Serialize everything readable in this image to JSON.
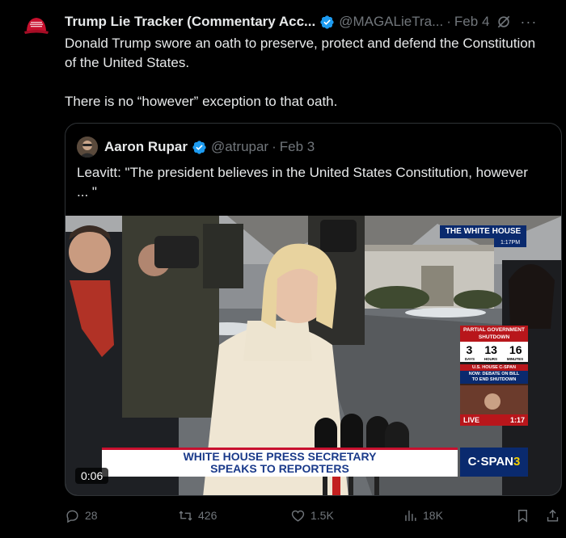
{
  "tweet": {
    "author_name": "Trump Lie Tracker (Commentary Acc...",
    "handle": "@MAGALieTra...",
    "separator": "·",
    "date": "Feb 4",
    "more": "···",
    "text": "Donald Trump swore an oath to preserve, protect and defend the Constitution of the United States.\n\nThere is no “however” exception to that oath."
  },
  "quote": {
    "author_name": "Aaron Rupar",
    "handle": "@atrupar",
    "separator": "·",
    "date": "Feb 3",
    "text": "Leavitt: \"The president believes in the United States Constitution, however ... \"",
    "video": {
      "duration": "0:06",
      "lower_third_line1": "WHITE HOUSE PRESS SECRETARY",
      "lower_third_line2": "SPEAKS TO REPORTERS",
      "location_tag": "THE WHITE HOUSE",
      "time_tag": "1:17PM",
      "shutdown_title_1": "PARTIAL GOVERNMENT",
      "shutdown_title_2": "SHUTDOWN",
      "days": "3",
      "hours": "13",
      "minutes": "16",
      "days_label": "DAYS",
      "hours_label": "HOURS",
      "minutes_label": "MINUTES",
      "cspan_house_tag": "U.S. HOUSE C-SPAN",
      "cspan_now_1": "NOW: DEBATE ON BILL",
      "cspan_now_2": "TO END SHUTDOWN",
      "live_label": "LIVE",
      "live_time": "1:17",
      "network": "C·SPAN",
      "network_number": "3"
    }
  },
  "actions": {
    "replies": "28",
    "reposts": "426",
    "likes": "1.5K",
    "views": "18K"
  },
  "colors": {
    "background": "#000000",
    "text": "#e7e9ea",
    "muted": "#71767b",
    "verified": "#1d9bf0",
    "border": "#2f3336"
  }
}
